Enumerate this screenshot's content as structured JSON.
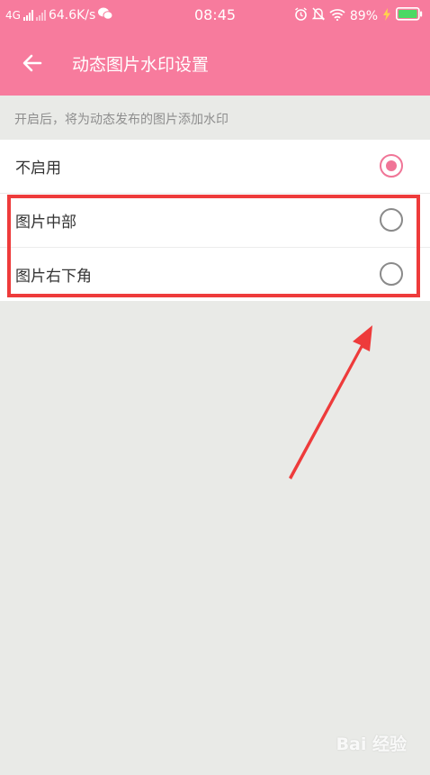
{
  "status_bar": {
    "network": "4G",
    "speed": "64.6K/s",
    "time": "08:45",
    "battery_percent": "89%",
    "battery_level": 0.89
  },
  "header": {
    "title": "动态图片水印设置",
    "back_icon": "arrow-left-icon"
  },
  "description": "开启后，将为动态发布的图片添加水印",
  "options": [
    {
      "label": "不启用",
      "selected": true
    },
    {
      "label": "图片中部",
      "selected": false
    },
    {
      "label": "图片右下角",
      "selected": false
    }
  ],
  "watermark": "Bai 经验",
  "colors": {
    "accent": "#f77b9d",
    "radio_checked": "#f07597",
    "annotation": "#ee3b3b",
    "background": "#e9eae7"
  }
}
